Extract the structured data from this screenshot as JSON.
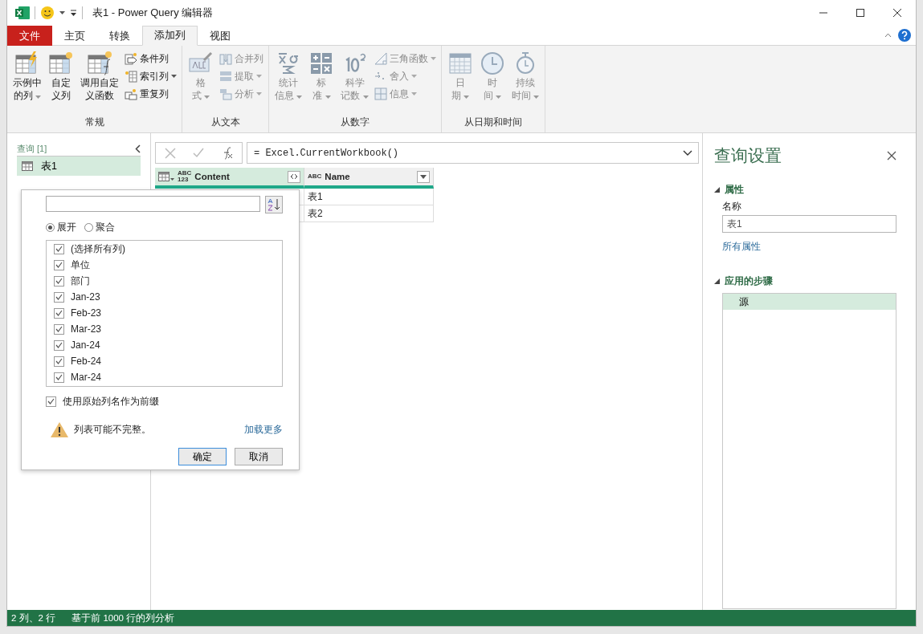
{
  "window": {
    "title": "表1 - Power Query 编辑器"
  },
  "menu_tabs": [
    {
      "label": "文件",
      "kind": "file",
      "selected": false
    },
    {
      "label": "主页",
      "kind": "tab",
      "selected": false
    },
    {
      "label": "转换",
      "kind": "tab",
      "selected": false
    },
    {
      "label": "添加列",
      "kind": "tab",
      "selected": true
    },
    {
      "label": "视图",
      "kind": "tab",
      "selected": false
    }
  ],
  "ribbon": {
    "groups": [
      {
        "label": "常规",
        "large": [
          {
            "lines": [
              "示例中",
              "的列"
            ],
            "dropdown": true,
            "disabled": false
          },
          {
            "lines": [
              "自定",
              "义列"
            ],
            "dropdown": false,
            "disabled": false
          },
          {
            "lines": [
              "调用自定",
              "义函数"
            ],
            "dropdown": false,
            "disabled": false
          }
        ],
        "small": [
          {
            "label": "条件列",
            "dropdown": false,
            "disabled": false
          },
          {
            "label": "索引列",
            "dropdown": true,
            "disabled": false
          },
          {
            "label": "重复列",
            "dropdown": false,
            "disabled": false
          }
        ]
      },
      {
        "label": "从文本",
        "large": [
          {
            "lines": [
              "格",
              "式"
            ],
            "dropdown": true,
            "disabled": true
          }
        ],
        "small": [
          {
            "label": "合并列",
            "dropdown": false,
            "disabled": true
          },
          {
            "label": "提取",
            "dropdown": true,
            "disabled": true
          },
          {
            "label": "分析",
            "dropdown": true,
            "disabled": true
          }
        ]
      },
      {
        "label": "从数字",
        "large": [
          {
            "lines": [
              "统计",
              "信息"
            ],
            "dropdown": true,
            "disabled": true
          },
          {
            "lines": [
              "标",
              "准"
            ],
            "dropdown": true,
            "disabled": true
          },
          {
            "lines": [
              "科学",
              "记数"
            ],
            "dropdown": true,
            "disabled": true
          }
        ],
        "small": [
          {
            "label": "三角函数",
            "dropdown": true,
            "disabled": true
          },
          {
            "label": "舍入",
            "dropdown": true,
            "disabled": true
          },
          {
            "label": "信息",
            "dropdown": true,
            "disabled": true
          }
        ]
      },
      {
        "label": "从日期和时间",
        "large": [
          {
            "lines": [
              "日",
              "期"
            ],
            "dropdown": true,
            "disabled": true
          },
          {
            "lines": [
              "时",
              "间"
            ],
            "dropdown": true,
            "disabled": true
          },
          {
            "lines": [
              "持续",
              "时间"
            ],
            "dropdown": true,
            "disabled": true
          }
        ]
      }
    ]
  },
  "queries": {
    "header": "查询 [1]",
    "items": [
      {
        "label": "表1",
        "selected": true
      }
    ]
  },
  "formula_bar": {
    "formula": "= Excel.CurrentWorkbook()"
  },
  "table": {
    "columns": [
      {
        "name": "Content",
        "type": "ABC\n123",
        "selected": true
      },
      {
        "name": "Name",
        "type": "ABC",
        "selected": false
      }
    ],
    "rows": [
      {
        "name": "表1"
      },
      {
        "name": "表2"
      }
    ]
  },
  "expand_popup": {
    "modes": [
      {
        "label": "展开",
        "selected": true
      },
      {
        "label": "聚合",
        "selected": false
      }
    ],
    "columns": [
      {
        "label": "(选择所有列)",
        "checked": true
      },
      {
        "label": "单位",
        "checked": true
      },
      {
        "label": "部门",
        "checked": true
      },
      {
        "label": "Jan-23",
        "checked": true
      },
      {
        "label": "Feb-23",
        "checked": true
      },
      {
        "label": "Mar-23",
        "checked": true
      },
      {
        "label": "Jan-24",
        "checked": true
      },
      {
        "label": "Feb-24",
        "checked": true
      },
      {
        "label": "Mar-24",
        "checked": true
      }
    ],
    "prefix": {
      "label": "使用原始列名作为前缀",
      "checked": true
    },
    "warning": "列表可能不完整。",
    "load_more": "加载更多",
    "buttons": [
      {
        "label": "确定",
        "kind": "primary"
      },
      {
        "label": "取消",
        "kind": "secondary"
      }
    ]
  },
  "settings": {
    "title": "查询设置",
    "properties": {
      "header": "属性",
      "expanded": true,
      "name_label": "名称",
      "name_value": "表1",
      "all_link": "所有属性"
    },
    "steps": {
      "header": "应用的步骤",
      "expanded": true,
      "items": [
        {
          "label": "源",
          "selected": true
        }
      ]
    }
  },
  "status_bar": {
    "counts": "2 列、2 行",
    "profile": "基于前 1000 行的列分析"
  }
}
